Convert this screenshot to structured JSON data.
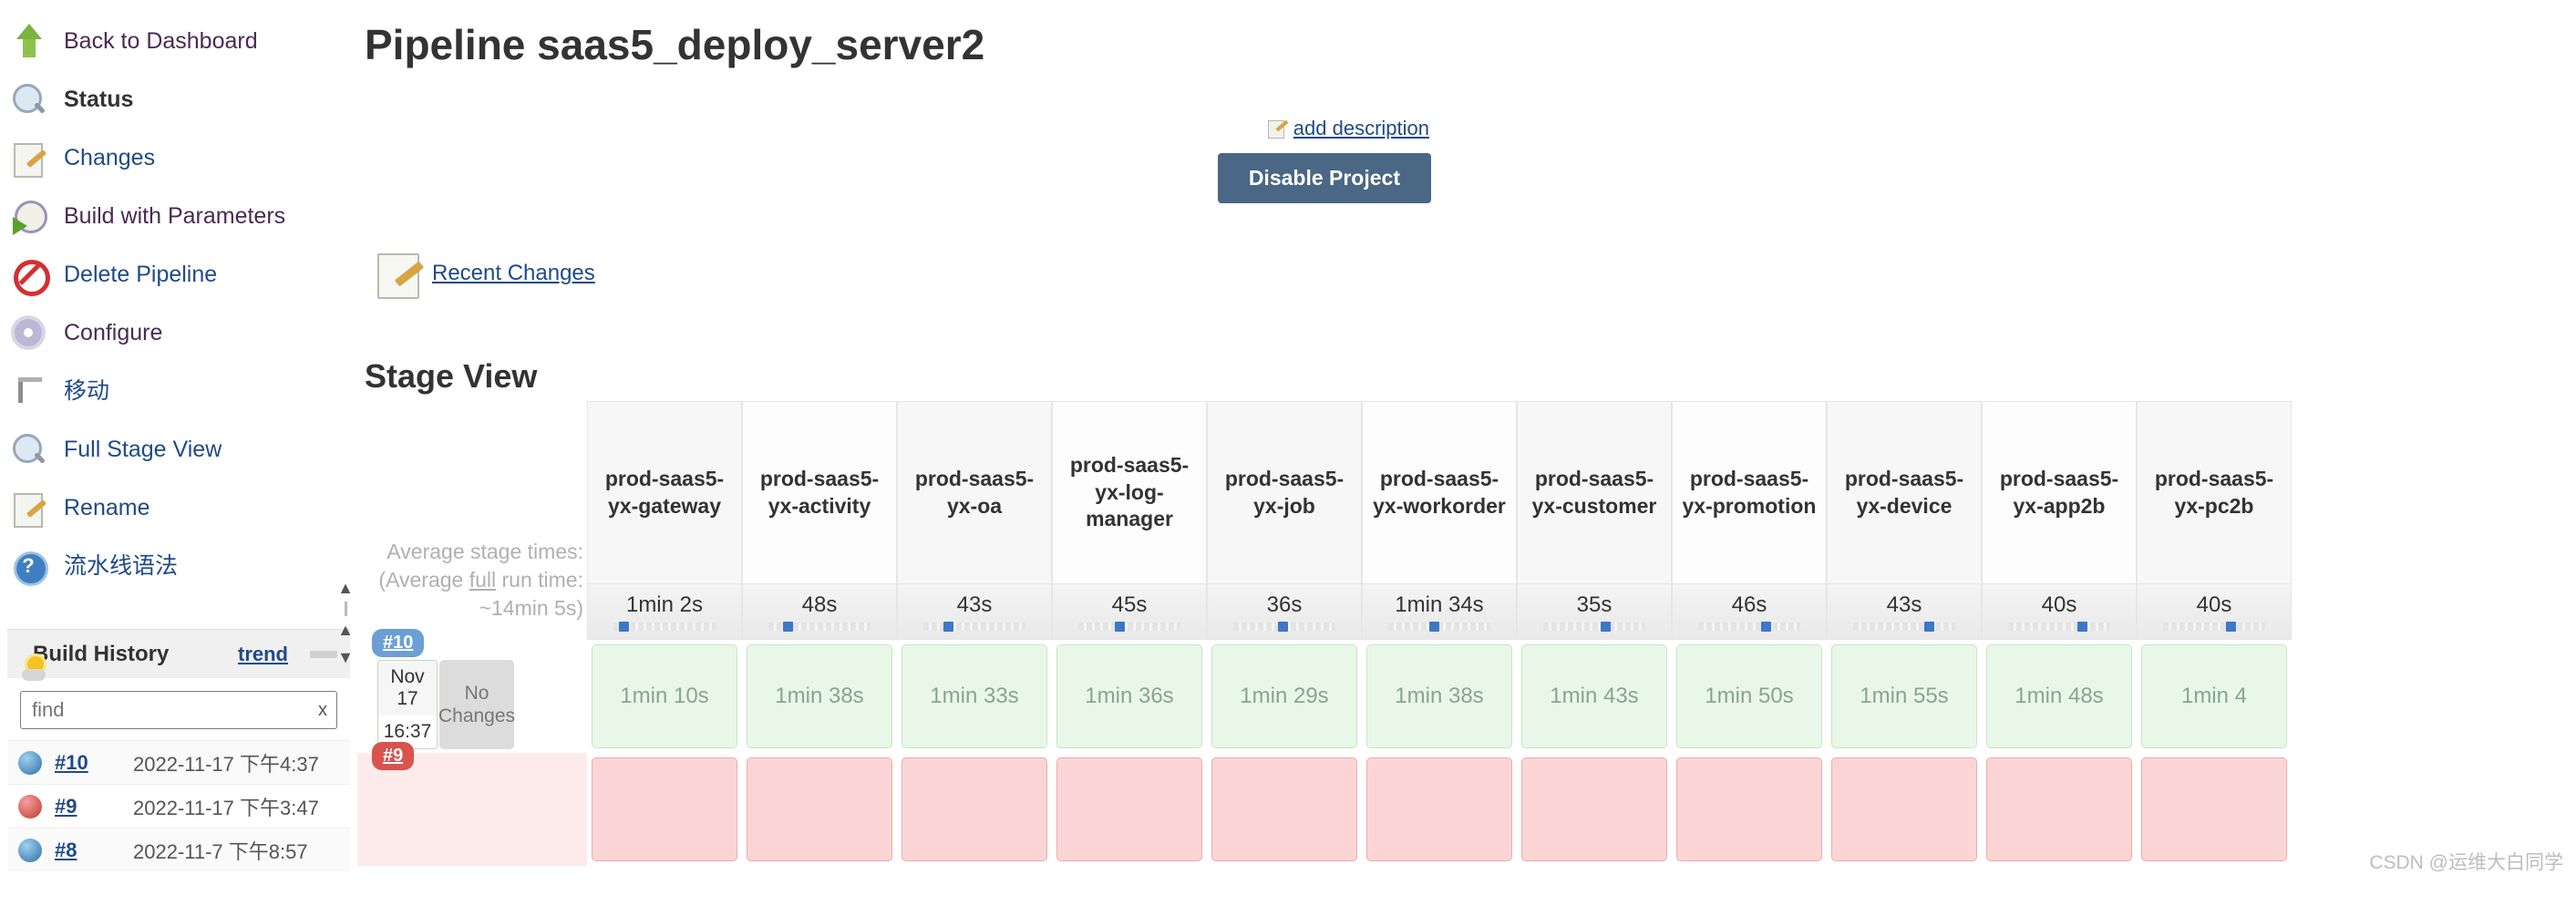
{
  "sidebar": {
    "items": [
      {
        "label": "Back to Dashboard",
        "icon": "up-arrow-icon",
        "style": "purple",
        "active": false
      },
      {
        "label": "Status",
        "icon": "magnifier-icon",
        "style": "active",
        "active": true
      },
      {
        "label": "Changes",
        "icon": "notepad-pencil-icon",
        "style": "link",
        "active": false
      },
      {
        "label": "Build with Parameters",
        "icon": "clock-play-icon",
        "style": "purple",
        "active": false
      },
      {
        "label": "Delete Pipeline",
        "icon": "deny-icon",
        "style": "link",
        "active": false
      },
      {
        "label": "Configure",
        "icon": "gear-icon",
        "style": "purple",
        "active": false
      },
      {
        "label": "移动",
        "icon": "crane-icon",
        "style": "link",
        "active": false
      },
      {
        "label": "Full Stage View",
        "icon": "magnifier-icon",
        "style": "link",
        "active": false
      },
      {
        "label": "Rename",
        "icon": "notepad-pencil-icon",
        "style": "link",
        "active": false
      },
      {
        "label": "流水线语法",
        "icon": "help-icon",
        "style": "link",
        "active": false
      }
    ]
  },
  "build_history": {
    "title": "Build History",
    "trend_label": "trend",
    "search_value": "find",
    "search_placeholder": "find",
    "clear_label": "x",
    "rows": [
      {
        "number": "#10",
        "date": "2022-11-17 下午4:37",
        "status": "blue"
      },
      {
        "number": "#9",
        "date": "2022-11-17 下午3:47",
        "status": "red"
      },
      {
        "number": "#8",
        "date": "2022-11-7 下午8:57",
        "status": "blue"
      }
    ]
  },
  "scroll": {
    "up": "▲",
    "down": "▼",
    "top": "▲"
  },
  "header": {
    "title": "Pipeline saas5_deploy_server2",
    "add_description": "add description",
    "disable_project": "Disable Project",
    "recent_changes": "Recent Changes"
  },
  "stage_view": {
    "heading": "Stage View",
    "average_note_line1": "Average stage times:",
    "average_note_line2_a": "(Average ",
    "average_note_line2_u": "full",
    "average_note_line2_b": " run time: ~14min 5s)",
    "no_changes": "No Changes"
  },
  "chart_data": {
    "type": "table",
    "title": "Stage View",
    "columns": [
      "prod-saas5-yx-gateway",
      "prod-saas5-yx-activity",
      "prod-saas5-yx-oa",
      "prod-saas5-yx-log-manager",
      "prod-saas5-yx-job",
      "prod-saas5-yx-workorder",
      "prod-saas5-yx-customer",
      "prod-saas5-yx-promotion",
      "prod-saas5-yx-device",
      "prod-saas5-yx-app2b",
      "prod-saas5-yx-pc2b"
    ],
    "average_times": [
      "1min 2s",
      "48s",
      "43s",
      "45s",
      "36s",
      "1min 34s",
      "35s",
      "46s",
      "43s",
      "40s",
      "40s"
    ],
    "sparkline_marker_pct": [
      5,
      14,
      20,
      36,
      44,
      40,
      56,
      62,
      70,
      68,
      62
    ],
    "rows": [
      {
        "build": "#10",
        "status": "passed",
        "date": "Nov 17",
        "time": "16:37",
        "changes": "No Changes",
        "values": [
          "1min 10s",
          "1min 38s",
          "1min 33s",
          "1min 36s",
          "1min 29s",
          "1min 38s",
          "1min 43s",
          "1min 50s",
          "1min 55s",
          "1min 48s",
          "1min 4"
        ]
      },
      {
        "build": "#9",
        "status": "failed",
        "date": "",
        "time": "",
        "changes": "",
        "values": [
          "",
          "",
          "",
          "",
          "",
          "",
          "",
          "",
          "",
          "",
          ""
        ]
      }
    ]
  },
  "watermark": "CSDN @运维大白同学"
}
